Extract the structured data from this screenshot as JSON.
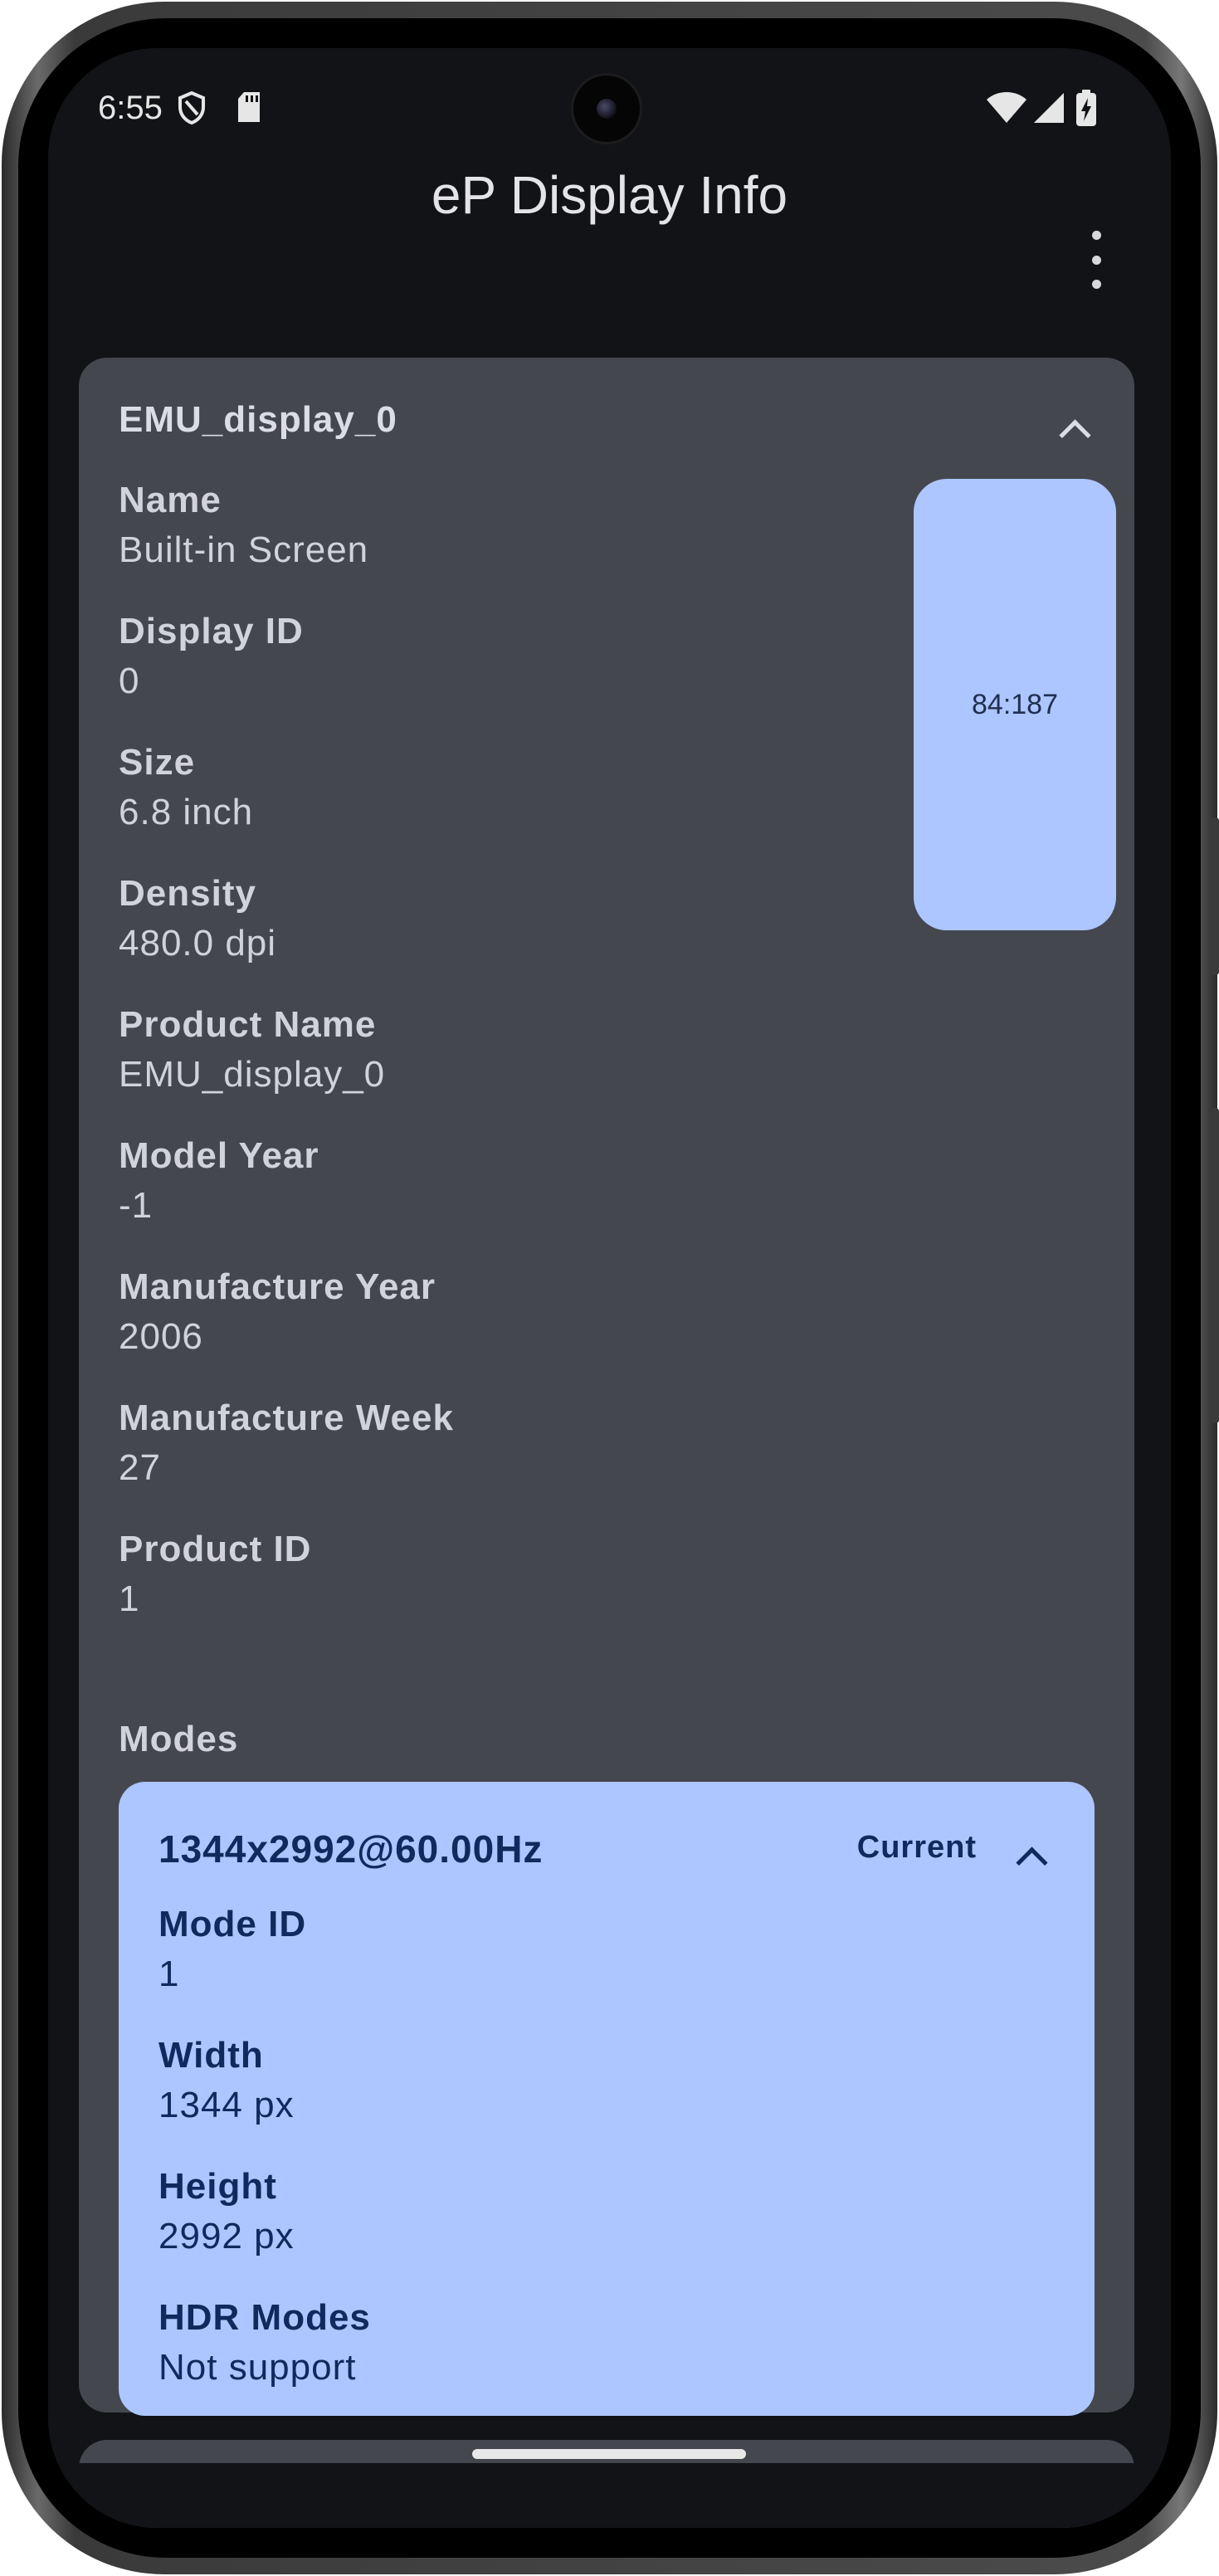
{
  "status_bar": {
    "time": "6:55",
    "icons": [
      "shield-icon",
      "sd-card-icon",
      "wifi-icon",
      "cellular-signal-icon",
      "battery-charging-icon"
    ]
  },
  "app_bar": {
    "title": "eP Display Info",
    "menu_icon": "more-vertical-icon"
  },
  "display_card": {
    "title": "EMU_display_0",
    "aspect_ratio_label": "84:187",
    "fields": [
      {
        "label": "Name",
        "value": "Built-in Screen"
      },
      {
        "label": "Display ID",
        "value": "0"
      },
      {
        "label": "Size",
        "value": "6.8 inch"
      },
      {
        "label": "Density",
        "value": "480.0 dpi"
      },
      {
        "label": "Product Name",
        "value": "EMU_display_0"
      },
      {
        "label": "Model Year",
        "value": "-1"
      },
      {
        "label": "Manufacture Year",
        "value": "2006"
      },
      {
        "label": "Manufacture Week",
        "value": "27"
      },
      {
        "label": "Product ID",
        "value": "1"
      }
    ],
    "modes_label": "Modes",
    "mode": {
      "title": "1344x2992@60.00Hz",
      "badge": "Current",
      "fields": [
        {
          "label": "Mode ID",
          "value": "1"
        },
        {
          "label": "Width",
          "value": "1344 px"
        },
        {
          "label": "Height",
          "value": "2992 px"
        },
        {
          "label": "HDR Modes",
          "value": "Not support"
        }
      ]
    }
  },
  "colors": {
    "screen_bg": "#121316",
    "card_bg": "#45474f",
    "accent": "#adc6ff",
    "accent_text": "#0f2a5c"
  }
}
